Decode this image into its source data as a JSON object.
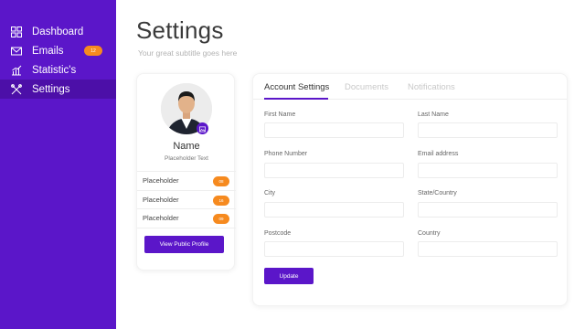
{
  "sidebar": {
    "items": [
      {
        "label": "Dashboard",
        "icon": "dashboard-icon"
      },
      {
        "label": "Emails",
        "icon": "envelope-icon",
        "badge": "12"
      },
      {
        "label": "Statistic's",
        "icon": "chart-icon"
      },
      {
        "label": "Settings",
        "icon": "tools-icon",
        "active": true
      }
    ]
  },
  "header": {
    "title": "Settings",
    "subtitle": "Your great subtitle goes here"
  },
  "profile": {
    "name": "Name",
    "subtitle": "Placeholder Text",
    "items": [
      {
        "label": "Placeholder",
        "badge": "08"
      },
      {
        "label": "Placeholder",
        "badge": "16"
      },
      {
        "label": "Placeholder",
        "badge": "09"
      }
    ],
    "button_label": "View Public Profile"
  },
  "settings": {
    "tabs": [
      "Account Settings",
      "Documents",
      "Notifications"
    ],
    "fields": {
      "first_name": "First Name",
      "last_name": "Last Name",
      "phone": "Phone Number",
      "email": "Email address",
      "city": "City",
      "state": "State/Country",
      "postcode": "Postcode",
      "country": "Country"
    },
    "update_label": "Update"
  },
  "colors": {
    "accent": "#5b16c9",
    "sidebar_active": "#4c0fa8",
    "badge": "#f68a1f"
  }
}
